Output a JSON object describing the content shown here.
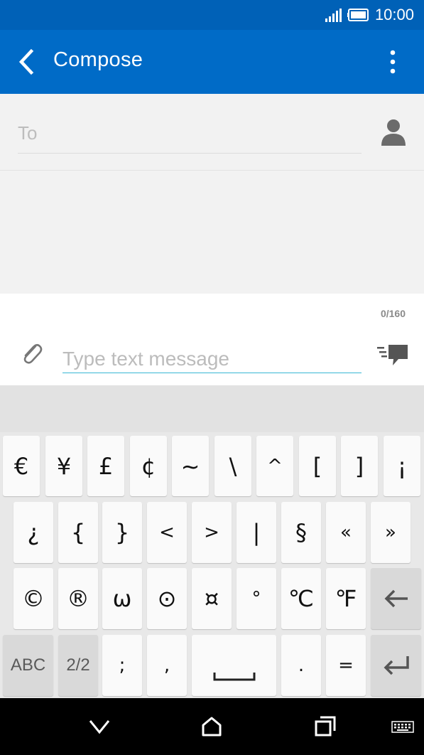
{
  "status": {
    "time": "10:00"
  },
  "appbar": {
    "title": "Compose"
  },
  "recipient": {
    "placeholder": "To"
  },
  "compose": {
    "counter": "0/160",
    "placeholder": "Type text message"
  },
  "keyboard": {
    "row1": [
      "€",
      "¥",
      "£",
      "¢",
      "~",
      "\\",
      "^",
      "[",
      "]",
      "¡"
    ],
    "row2": [
      "¿",
      "{",
      "}",
      "<",
      ">",
      "|",
      "§",
      "«",
      "»"
    ],
    "row3": [
      "©",
      "®",
      "ω",
      "⊙",
      "¤",
      "°",
      "℃",
      "℉"
    ],
    "abc_label": "ABC",
    "page_label": "2/2",
    "semicolon": ";",
    "comma": ",",
    "period": ".",
    "equals": "="
  }
}
